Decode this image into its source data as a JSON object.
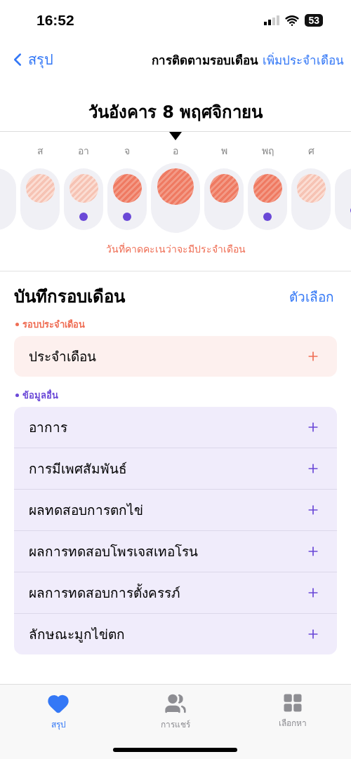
{
  "status_bar": {
    "time": "16:52",
    "battery": "53"
  },
  "nav": {
    "back": "สรุป",
    "title": "การติดตามรอบเดือน",
    "action": "เพิ่มประจำเดือน"
  },
  "date_title": "วันอังคาร 8 พฤศจิกายน",
  "days": [
    {
      "kind": "partial",
      "dot": false
    },
    {
      "kind": "light",
      "label": "ส",
      "dot": false,
      "selected": false
    },
    {
      "kind": "light",
      "label": "อา",
      "dot": true,
      "selected": false
    },
    {
      "kind": "strong",
      "label": "จ",
      "dot": true,
      "selected": false
    },
    {
      "kind": "strong",
      "label": "อ",
      "dot": false,
      "selected": true
    },
    {
      "kind": "strong",
      "label": "พ",
      "dot": false,
      "selected": false
    },
    {
      "kind": "strong",
      "label": "พฤ",
      "dot": true,
      "selected": false
    },
    {
      "kind": "light",
      "label": "ศ",
      "dot": false,
      "selected": false
    },
    {
      "kind": "partial",
      "dot": true
    }
  ],
  "caption": "วันที่คาดคะเนว่าจะมีประจำเดือน",
  "log": {
    "title": "บันทึกรอบเดือน",
    "options": "ตัวเลือก",
    "groups": [
      {
        "label": "รอบประจำเดือน",
        "color": "#ef6e55",
        "items": [
          "ประจำเดือน"
        ]
      },
      {
        "label": "ข้อมูลอื่น",
        "color": "#6a48d7",
        "items": [
          "อาการ",
          "การมีเพศสัมพันธ์",
          "ผลทดสอบการตกไข่",
          "ผลการทดสอบโพรเจสเทอโรน",
          "ผลการทดสอบการตั้งครรภ์",
          "ลักษณะมูกไข่ตก"
        ]
      }
    ]
  },
  "tab_bar": [
    {
      "label": "สรุป",
      "selected": true
    },
    {
      "label": "การแชร์",
      "selected": false
    },
    {
      "label": "เลือกหา",
      "selected": false
    }
  ]
}
